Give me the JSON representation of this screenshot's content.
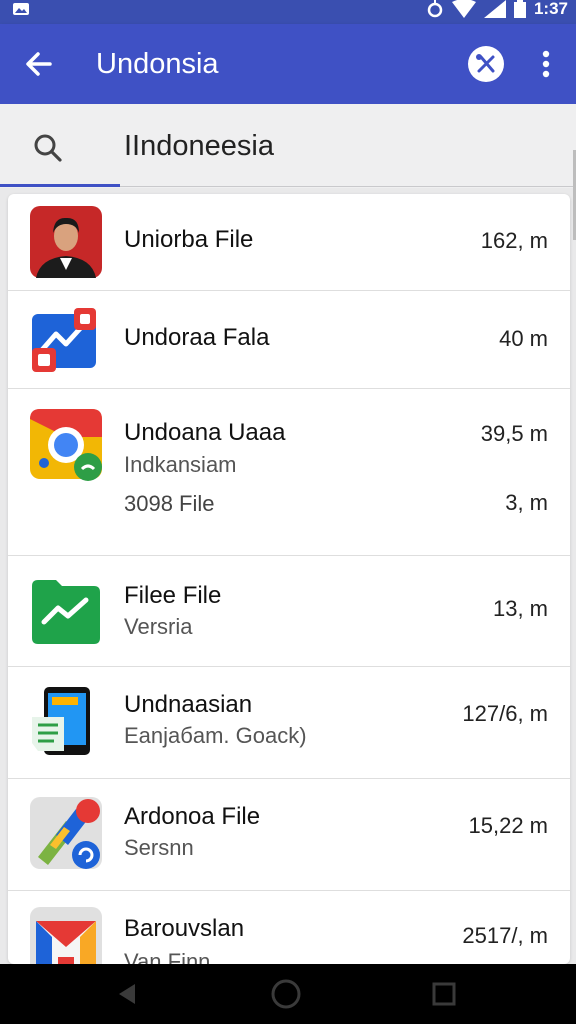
{
  "status_bar": {
    "time": "1:37",
    "icons": [
      "image-notification-icon",
      "alarm-icon",
      "wifi-icon",
      "signal-icon",
      "battery-icon"
    ]
  },
  "app_bar": {
    "title": "Undonsia",
    "back_icon": "arrow-back-icon",
    "action_icon": "tools-icon",
    "more_icon": "more-vert-icon",
    "color": "#3f51c5"
  },
  "search": {
    "value": "IIndoneesia",
    "icon": "search-icon"
  },
  "files": [
    {
      "title": "Uniorba File",
      "subtitle": "",
      "size": "162, m",
      "icon": "profile-photo-icon"
    },
    {
      "title": "Undoraa Fala",
      "subtitle": "",
      "size": "40 m",
      "icon": "analytics-chart-icon"
    },
    {
      "title": "Undoana Uaaa",
      "subtitle": "Indkansiam",
      "extra_title": "3098 File",
      "size": "39,5 m",
      "extra_size": "3, m",
      "icon": "chrome-icon"
    },
    {
      "title": "Filee File",
      "subtitle": "Versria",
      "size": "13, m",
      "icon": "green-folder-chart-icon"
    },
    {
      "title": "Undnaasian",
      "subtitle": "Eanjaбam. Goack)",
      "size": "127/6, m",
      "icon": "phone-document-icon"
    },
    {
      "title": "Ardonoa File",
      "subtitle": "Sersnn",
      "size": "15,22 m",
      "icon": "colorful-tools-icon"
    },
    {
      "title": "Barouvslan",
      "subtitle": "Van Finn",
      "size": "2517/, m",
      "icon": "gmail-icon"
    }
  ],
  "nav": {
    "back": "nav-back-icon",
    "home": "nav-home-icon",
    "recents": "nav-recents-icon"
  }
}
